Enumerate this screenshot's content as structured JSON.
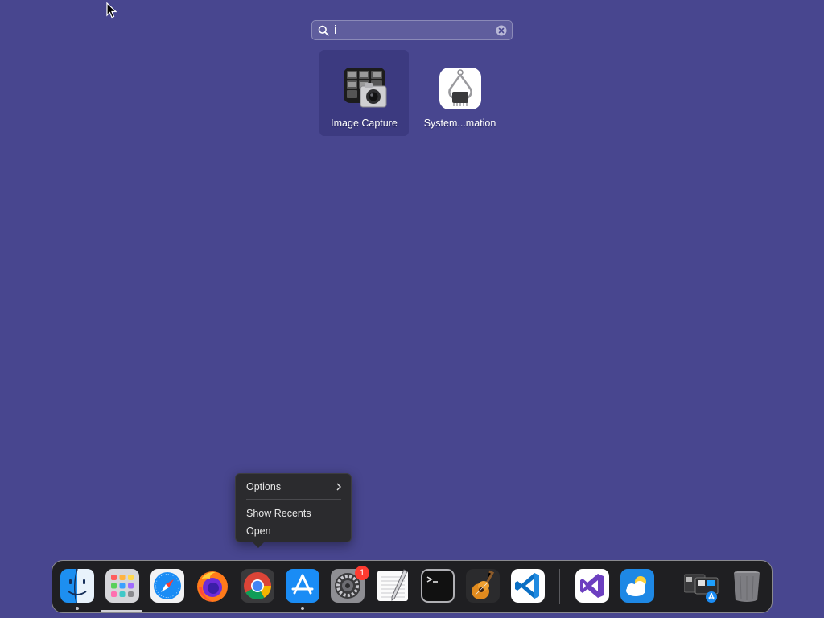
{
  "search": {
    "query": "i",
    "icon": "magnifying-glass-icon",
    "clear_icon": "clear-circle-icon"
  },
  "results": [
    {
      "label": "Image Capture",
      "icon": "image-capture-icon",
      "selected": true
    },
    {
      "label": "System...mation",
      "icon": "system-information-icon",
      "selected": false
    }
  ],
  "context_menu": {
    "items": [
      {
        "label": "Options",
        "has_submenu": true
      },
      {
        "label": "Show Recents"
      },
      {
        "label": "Open"
      }
    ]
  },
  "dock": {
    "apps": [
      {
        "name": "Finder",
        "icon": "finder-icon",
        "running": true
      },
      {
        "name": "Launchpad",
        "icon": "launchpad-icon",
        "running": false
      },
      {
        "name": "Safari",
        "icon": "safari-icon",
        "running": false
      },
      {
        "name": "Firefox",
        "icon": "firefox-icon",
        "running": false
      },
      {
        "name": "Chrome",
        "icon": "chrome-icon",
        "running": false
      },
      {
        "name": "App Store",
        "icon": "app-store-icon",
        "running": true
      },
      {
        "name": "System Settings",
        "icon": "system-settings-icon",
        "running": false,
        "badge": "1"
      },
      {
        "name": "TextEdit",
        "icon": "textedit-icon",
        "running": false
      },
      {
        "name": "Terminal",
        "icon": "terminal-icon",
        "running": false
      },
      {
        "name": "GarageBand",
        "icon": "garageband-icon",
        "running": false
      },
      {
        "name": "Visual Studio Code",
        "icon": "vscode-icon",
        "running": false
      },
      {
        "name": "Visual Studio",
        "icon": "visual-studio-icon",
        "running": false
      },
      {
        "name": "Weather",
        "icon": "weather-icon",
        "running": false
      },
      {
        "name": "Downloads Stack",
        "icon": "downloads-stack-icon",
        "running": false
      },
      {
        "name": "Trash",
        "icon": "trash-icon",
        "running": false
      }
    ]
  },
  "colors": {
    "desktop_bg": "#48468f",
    "selected_tile": "#3c3a80",
    "badge": "#ff3b30",
    "menu_bg": "#2b2b2e",
    "dock_bg": "#1f1f22"
  }
}
